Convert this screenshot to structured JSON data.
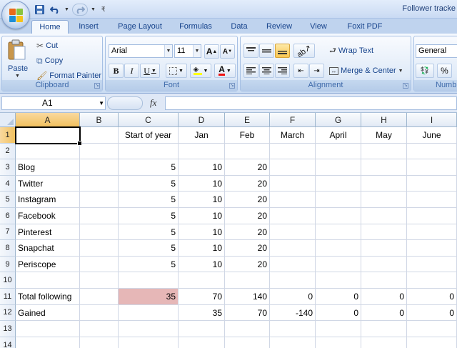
{
  "app": {
    "doc_title": "Follower tracke",
    "qat": {
      "save_icon": "save-icon",
      "undo_icon": "undo-icon",
      "redo_icon": "redo-icon"
    }
  },
  "tabs": [
    "Home",
    "Insert",
    "Page Layout",
    "Formulas",
    "Data",
    "Review",
    "View",
    "Foxit PDF"
  ],
  "ribbon": {
    "clipboard": {
      "label": "Clipboard",
      "paste": "Paste",
      "cut": "Cut",
      "copy": "Copy",
      "format_painter": "Format Painter"
    },
    "font": {
      "label": "Font",
      "name": "Arial",
      "size": "11",
      "bold": "B",
      "italic": "I",
      "underline": "U",
      "grow": "A",
      "shrink": "A",
      "font_color": "A"
    },
    "alignment": {
      "label": "Alignment",
      "wrap_text": "Wrap Text",
      "merge_center": "Merge & Center"
    },
    "number": {
      "label": "Numb",
      "format": "General",
      "percent": "%"
    }
  },
  "formula_bar": {
    "name_box": "A1",
    "fx": "fx",
    "content": ""
  },
  "grid": {
    "columns": [
      "A",
      "B",
      "C",
      "D",
      "E",
      "F",
      "G",
      "H",
      "I"
    ],
    "rows": [
      "1",
      "2",
      "3",
      "4",
      "5",
      "6",
      "7",
      "8",
      "9",
      "10",
      "11",
      "12",
      "13",
      "14"
    ],
    "cells": {
      "r1": [
        "",
        "",
        "Start of year",
        "Jan",
        "Feb",
        "March",
        "April",
        "May",
        "June"
      ],
      "r2": [
        "",
        "",
        "",
        "",
        "",
        "",
        "",
        "",
        ""
      ],
      "r3": [
        "Blog",
        "",
        "5",
        "10",
        "20",
        "",
        "",
        "",
        ""
      ],
      "r4": [
        "Twitter",
        "",
        "5",
        "10",
        "20",
        "",
        "",
        "",
        ""
      ],
      "r5": [
        "Instagram",
        "",
        "5",
        "10",
        "20",
        "",
        "",
        "",
        ""
      ],
      "r6": [
        "Facebook",
        "",
        "5",
        "10",
        "20",
        "",
        "",
        "",
        ""
      ],
      "r7": [
        "Pinterest",
        "",
        "5",
        "10",
        "20",
        "",
        "",
        "",
        ""
      ],
      "r8": [
        "Snapchat",
        "",
        "5",
        "10",
        "20",
        "",
        "",
        "",
        ""
      ],
      "r9": [
        "Periscope",
        "",
        "5",
        "10",
        "20",
        "",
        "",
        "",
        ""
      ],
      "r10": [
        "",
        "",
        "",
        "",
        "",
        "",
        "",
        "",
        ""
      ],
      "r11": [
        "Total following",
        "",
        "35",
        "70",
        "140",
        "0",
        "0",
        "0",
        "0"
      ],
      "r12": [
        "Gained",
        "",
        "",
        "35",
        "70",
        "-140",
        "0",
        "0",
        "0"
      ],
      "r13": [
        "",
        "",
        "",
        "",
        "",
        "",
        "",
        "",
        ""
      ],
      "r14": [
        "",
        "",
        "",
        "",
        "",
        "",
        "",
        "",
        ""
      ]
    },
    "highlight_color": "#e6b7b7",
    "active_cell": "A1"
  }
}
